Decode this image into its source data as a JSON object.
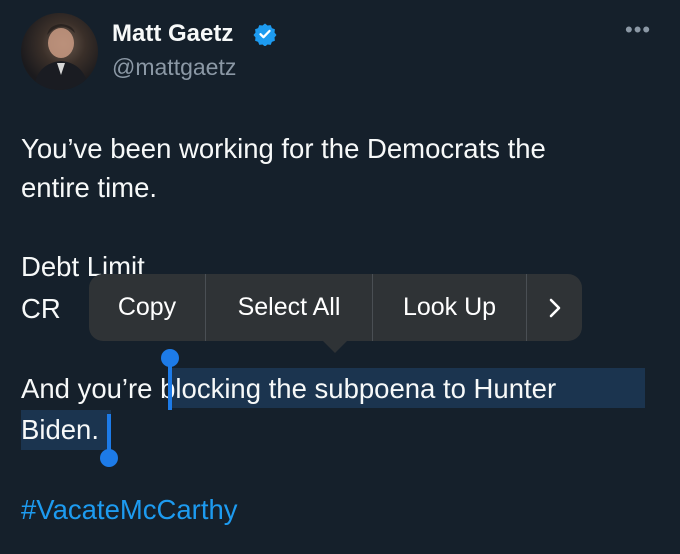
{
  "author": {
    "display_name": "Matt Gaetz",
    "handle": "@mattgaetz",
    "verified_icon": "verified-badge-icon"
  },
  "more_icon_label": "•••",
  "tweet": {
    "line1": "You’ve been working for the Democrats the",
    "line2": "entire time.",
    "line3": "Debt Limit",
    "line4": "CR",
    "line5_prefix": "And you’re ",
    "line5_selected": "blocking the subpoena to Hunter",
    "line6_selected": "Biden.",
    "hashtag": "#VacateMcCarthy"
  },
  "context_menu": {
    "items": [
      "Copy",
      "Select All",
      "Look Up"
    ],
    "more_label": ">"
  },
  "colors": {
    "background": "#15202b",
    "link": "#1d9bf0",
    "selection": "#1b344f",
    "handle": "#1d7be8",
    "menu": "#2f3336"
  }
}
